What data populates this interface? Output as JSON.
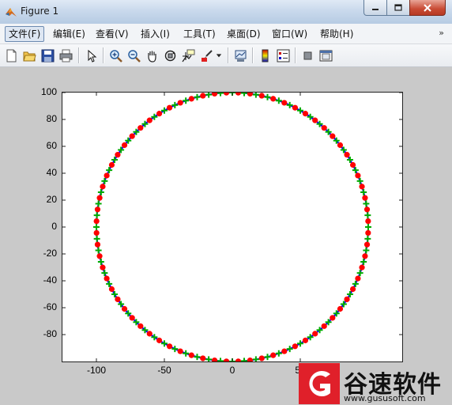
{
  "window": {
    "title": "Figure 1"
  },
  "menu": {
    "items": [
      {
        "label": "文件(F)"
      },
      {
        "label": "编辑(E)"
      },
      {
        "label": "查看(V)"
      },
      {
        "label": "插入(I)"
      },
      {
        "label": "工具(T)"
      },
      {
        "label": "桌面(D)"
      },
      {
        "label": "窗口(W)"
      },
      {
        "label": "帮助(H)"
      }
    ],
    "overflow": "»"
  },
  "toolbar": {
    "icons": [
      "new-figure-icon",
      "open-file-icon",
      "save-icon",
      "print-icon",
      "select-arrow-icon",
      "zoom-in-icon",
      "zoom-out-icon",
      "pan-hand-icon",
      "rotate-3d-icon",
      "data-cursor-icon",
      "brush-icon",
      "brush-dropdown-icon",
      "link-plot-icon",
      "colorbar-icon",
      "legend-icon",
      "hide-plot-tools-icon",
      "show-plot-tools-icon"
    ]
  },
  "chart_data": {
    "type": "scatter",
    "title": "",
    "xlabel": "",
    "ylabel": "",
    "xlim": [
      -125,
      125
    ],
    "ylim": [
      -100,
      100
    ],
    "xticks": [
      "-100",
      "-50",
      "0",
      "50"
    ],
    "yticks": [
      "100",
      "80",
      "60",
      "40",
      "20",
      "0",
      "-20",
      "-40",
      "-60",
      "-80"
    ],
    "series": [
      {
        "type": "line",
        "color": "#0000ff",
        "shape": "circle",
        "center": [
          0,
          0
        ],
        "radius": 100
      },
      {
        "type": "marker",
        "marker": "cross",
        "color": "#00aa00",
        "shape": "circle",
        "center": [
          0,
          0
        ],
        "radius": 100,
        "count": 72
      },
      {
        "type": "marker",
        "marker": "dot",
        "color": "#ff0000",
        "shape": "circle",
        "center": [
          0,
          0
        ],
        "radius": 100,
        "count": 72
      }
    ]
  },
  "watermark": {
    "name": "谷速软件",
    "url": "www.gususoft.com"
  },
  "colors": {
    "titlebar": "#c9d9ec",
    "figure_bg": "#c9c9c9",
    "line": "#0000ff",
    "marker_red": "#ff0000",
    "marker_green": "#00aa00",
    "brand_red": "#e0202a"
  }
}
